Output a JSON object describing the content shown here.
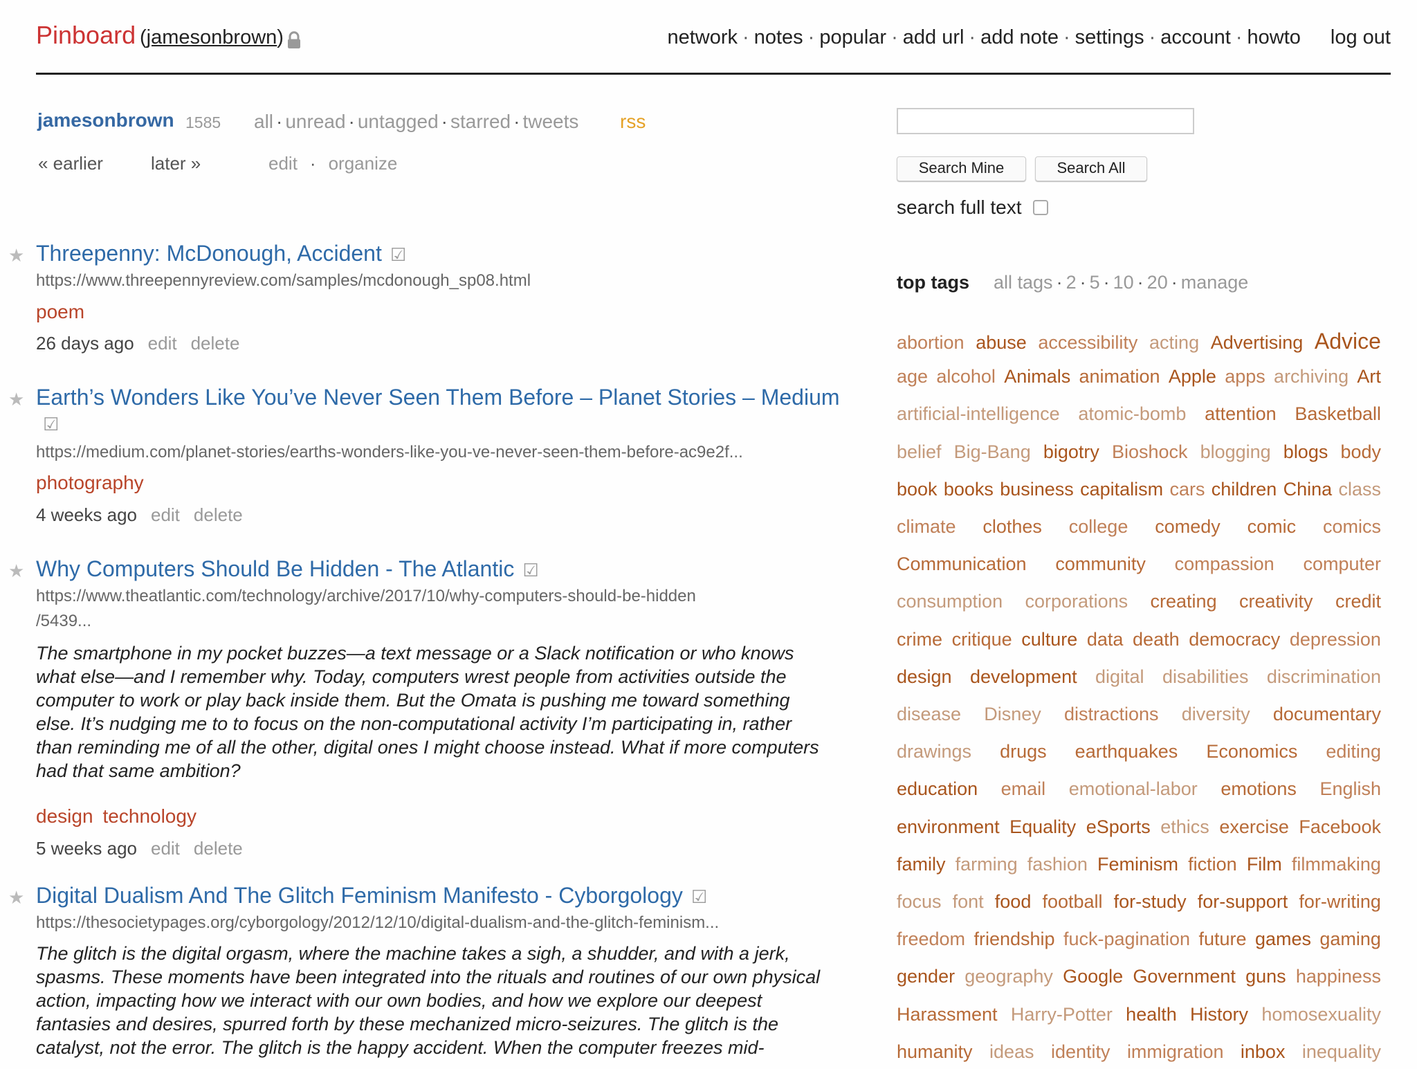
{
  "header": {
    "logo": "Pinboard",
    "paren_open": "(",
    "username": "jamesonbrown",
    "paren_close": ")",
    "nav": [
      "network",
      "notes",
      "popular",
      "add url",
      "add note",
      "settings",
      "account",
      "howto"
    ],
    "separator": "·",
    "logout": "log out"
  },
  "profile": {
    "user": "jamesonbrown",
    "count": "1585",
    "filters": [
      "all",
      "unread",
      "untagged",
      "starred",
      "tweets"
    ],
    "rss": "rss",
    "earlier": "« earlier",
    "later": "later »",
    "edit": "edit",
    "organize": "organize"
  },
  "bookmarks": [
    {
      "title": "Threepenny: McDonough, Accident",
      "url": "https://www.threepennyreview.com/samples/mcdonough_sp08.html",
      "tags": [
        "poem"
      ],
      "age": "26 days ago",
      "edit": "edit",
      "delete": "delete",
      "star": "★",
      "check": "☑"
    },
    {
      "title": "Earth’s Wonders Like You’ve Never Seen Them Before – Planet Stories – Medium",
      "url": "https://medium.com/planet-stories/earths-wonders-like-you-ve-never-seen-them-before-ac9e2f...",
      "tags": [
        "photography"
      ],
      "age": "4 weeks ago",
      "edit": "edit",
      "delete": "delete",
      "star": "★",
      "check": "☑"
    },
    {
      "title": "Why Computers Should Be Hidden - The Atlantic",
      "url_line1": "https://www.theatlantic.com/technology/archive/2017/10/why-computers-should-be-hidden",
      "url_line2": "/5439...",
      "description": "The smartphone in my pocket buzzes—a text message or a Slack notification or who knows what else—and I remember why. Today, computers wrest people from activities outside the computer to work or play back inside them. But the Omata is pushing me toward something else. It’s nudging me to to focus on the non-computational activity I’m participating in, rather than reminding me of all the other, digital ones I might choose instead. What if more computers had that same ambition?",
      "tags": [
        "design",
        "technology"
      ],
      "age": "5 weeks ago",
      "edit": "edit",
      "delete": "delete",
      "star": "★",
      "check": "☑"
    },
    {
      "title": "Digital Dualism And The Glitch Feminism Manifesto - Cyborgology",
      "url": "https://thesocietypages.org/cyborgology/2012/12/10/digital-dualism-and-the-glitch-feminism...",
      "description": "The glitch is the digital orgasm, where the machine takes a sigh, a shudder, and with a jerk, spasms. These moments have been integrated into the rituals and routines of our own physical action, impacting how we interact with our own bodies, and how we explore our deepest fantasies and desires, spurred forth by these mechanized micro-seizures. The glitch is the catalyst, not the error. The glitch is the happy accident. When the computer freezes mid-",
      "star": "★",
      "check": "☑"
    }
  ],
  "search": {
    "input_value": "",
    "search_mine": "Search Mine",
    "search_all": "Search All",
    "full_text_label": "search full text"
  },
  "top_tags": {
    "heading": "top tags",
    "options": [
      "all tags",
      "2",
      "5",
      "10",
      "20",
      "manage"
    ],
    "rows": [
      [
        {
          "t": "abortion",
          "w": 1
        },
        {
          "t": "abuse",
          "w": 3
        },
        {
          "t": "accessibility",
          "w": 1
        },
        {
          "t": "acting",
          "w": 0
        },
        {
          "t": "Advertising",
          "w": 3
        },
        {
          "t": "Advice",
          "w": 4
        }
      ],
      [
        {
          "t": "age",
          "w": 1
        },
        {
          "t": "alcohol",
          "w": 1
        },
        {
          "t": "Animals",
          "w": 3
        },
        {
          "t": "animation",
          "w": 2
        },
        {
          "t": "Apple",
          "w": 3
        },
        {
          "t": "apps",
          "w": 1
        },
        {
          "t": "archiving",
          "w": 0
        },
        {
          "t": "Art",
          "w": 3
        }
      ],
      [
        {
          "t": "artificial-intelligence",
          "w": 0
        },
        {
          "t": "atomic-bomb",
          "w": 0
        },
        {
          "t": "attention",
          "w": 2
        },
        {
          "t": "Basketball",
          "w": 2
        }
      ],
      [
        {
          "t": "belief",
          "w": 0
        },
        {
          "t": "Big-Bang",
          "w": 0
        },
        {
          "t": "bigotry",
          "w": 3
        },
        {
          "t": "Bioshock",
          "w": 1
        },
        {
          "t": "blogging",
          "w": 0
        },
        {
          "t": "blogs",
          "w": 3
        },
        {
          "t": "body",
          "w": 2
        }
      ],
      [
        {
          "t": "book",
          "w": 3
        },
        {
          "t": "books",
          "w": 3
        },
        {
          "t": "business",
          "w": 3
        },
        {
          "t": "capitalism",
          "w": 3
        },
        {
          "t": "cars",
          "w": 1
        },
        {
          "t": "children",
          "w": 3
        },
        {
          "t": "China",
          "w": 3
        },
        {
          "t": "class",
          "w": 0
        }
      ],
      [
        {
          "t": "climate",
          "w": 1
        },
        {
          "t": "clothes",
          "w": 2
        },
        {
          "t": "college",
          "w": 1
        },
        {
          "t": "comedy",
          "w": 2
        },
        {
          "t": "comic",
          "w": 2
        },
        {
          "t": "comics",
          "w": 1
        }
      ],
      [
        {
          "t": "Communication",
          "w": 2
        },
        {
          "t": "community",
          "w": 2
        },
        {
          "t": "compassion",
          "w": 1
        },
        {
          "t": "computer",
          "w": 1
        }
      ],
      [
        {
          "t": "consumption",
          "w": 0
        },
        {
          "t": "corporations",
          "w": 0
        },
        {
          "t": "creating",
          "w": 2
        },
        {
          "t": "creativity",
          "w": 2
        },
        {
          "t": "credit",
          "w": 2
        }
      ],
      [
        {
          "t": "crime",
          "w": 2
        },
        {
          "t": "critique",
          "w": 2
        },
        {
          "t": "culture",
          "w": 3
        },
        {
          "t": "data",
          "w": 2
        },
        {
          "t": "death",
          "w": 2
        },
        {
          "t": "democracy",
          "w": 2
        },
        {
          "t": "depression",
          "w": 1
        }
      ],
      [
        {
          "t": "design",
          "w": 3
        },
        {
          "t": "development",
          "w": 3
        },
        {
          "t": "digital",
          "w": 0
        },
        {
          "t": "disabilities",
          "w": 0
        },
        {
          "t": "discrimination",
          "w": 0
        }
      ],
      [
        {
          "t": "disease",
          "w": 0
        },
        {
          "t": "Disney",
          "w": 0
        },
        {
          "t": "distractions",
          "w": 1
        },
        {
          "t": "diversity",
          "w": 0
        },
        {
          "t": "documentary",
          "w": 2
        }
      ],
      [
        {
          "t": "drawings",
          "w": 0
        },
        {
          "t": "drugs",
          "w": 2
        },
        {
          "t": "earthquakes",
          "w": 2
        },
        {
          "t": "Economics",
          "w": 2
        },
        {
          "t": "editing",
          "w": 1
        }
      ],
      [
        {
          "t": "education",
          "w": 3
        },
        {
          "t": "email",
          "w": 1
        },
        {
          "t": "emotional-labor",
          "w": 0
        },
        {
          "t": "emotions",
          "w": 2
        },
        {
          "t": "English",
          "w": 1
        }
      ],
      [
        {
          "t": "environment",
          "w": 3
        },
        {
          "t": "Equality",
          "w": 3
        },
        {
          "t": "eSports",
          "w": 3
        },
        {
          "t": "ethics",
          "w": 0
        },
        {
          "t": "exercise",
          "w": 2
        },
        {
          "t": "Facebook",
          "w": 2
        }
      ],
      [
        {
          "t": "family",
          "w": 3
        },
        {
          "t": "farming",
          "w": 0
        },
        {
          "t": "fashion",
          "w": 0
        },
        {
          "t": "Feminism",
          "w": 3
        },
        {
          "t": "fiction",
          "w": 2
        },
        {
          "t": "Film",
          "w": 3
        },
        {
          "t": "filmmaking",
          "w": 1
        }
      ],
      [
        {
          "t": "focus",
          "w": 0
        },
        {
          "t": "font",
          "w": 0
        },
        {
          "t": "food",
          "w": 3
        },
        {
          "t": "football",
          "w": 2
        },
        {
          "t": "for-study",
          "w": 3
        },
        {
          "t": "for-support",
          "w": 3
        },
        {
          "t": "for-writing",
          "w": 2
        }
      ],
      [
        {
          "t": "freedom",
          "w": 1
        },
        {
          "t": "friendship",
          "w": 2
        },
        {
          "t": "fuck-pagination",
          "w": 1
        },
        {
          "t": "future",
          "w": 2
        },
        {
          "t": "games",
          "w": 3
        },
        {
          "t": "gaming",
          "w": 2
        }
      ],
      [
        {
          "t": "gender",
          "w": 3
        },
        {
          "t": "geography",
          "w": 0
        },
        {
          "t": "Google",
          "w": 3
        },
        {
          "t": "Government",
          "w": 3
        },
        {
          "t": "guns",
          "w": 3
        },
        {
          "t": "happiness",
          "w": 1
        }
      ],
      [
        {
          "t": "Harassment",
          "w": 2
        },
        {
          "t": "Harry-Potter",
          "w": 0
        },
        {
          "t": "health",
          "w": 3
        },
        {
          "t": "History",
          "w": 3
        },
        {
          "t": "homosexuality",
          "w": 0
        }
      ],
      [
        {
          "t": "humanity",
          "w": 2
        },
        {
          "t": "ideas",
          "w": 0
        },
        {
          "t": "identity",
          "w": 1
        },
        {
          "t": "immigration",
          "w": 1
        },
        {
          "t": "inbox",
          "w": 3
        },
        {
          "t": "inequality",
          "w": 0
        }
      ]
    ]
  },
  "colors": {
    "logo": "#cc3333",
    "link": "#2e6aa8",
    "tag": "#b9452a",
    "rss": "#e5a227",
    "muted": "#999999",
    "tag_weights": [
      "#c49a7b",
      "#c08058",
      "#b76a37",
      "#a9551d",
      "#a9551d"
    ]
  }
}
